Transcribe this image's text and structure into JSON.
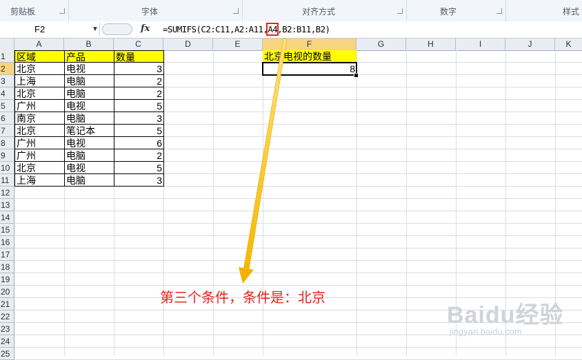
{
  "ribbon": {
    "groups": [
      {
        "label": "剪贴板"
      },
      {
        "label": "字体"
      },
      {
        "label": "对齐方式"
      },
      {
        "label": "数字"
      },
      {
        "label": "样式"
      }
    ]
  },
  "formula_bar": {
    "name_box": "F2",
    "fx_label": "fx",
    "formula_before": "=SUMIFS(C2:C11,A2:A11,",
    "formula_highlight": "A4",
    "formula_after": ",B2:B11,B2)"
  },
  "columns": [
    "A",
    "B",
    "C",
    "D",
    "E",
    "F",
    "G",
    "H",
    "I",
    "J",
    "K"
  ],
  "selected_column": "F",
  "rows": [
    "1",
    "2",
    "3",
    "4",
    "5",
    "6",
    "7",
    "8",
    "9",
    "10",
    "11",
    "12",
    "13",
    "14",
    "15",
    "16",
    "17",
    "18",
    "19",
    "20",
    "21",
    "22",
    "23",
    "24",
    "25"
  ],
  "selected_row": "2",
  "table": {
    "headers": [
      "区域",
      "产品",
      "数量"
    ],
    "rows": [
      [
        "北京",
        "电视",
        "3"
      ],
      [
        "上海",
        "电脑",
        "2"
      ],
      [
        "北京",
        "电脑",
        "2"
      ],
      [
        "广州",
        "电视",
        "5"
      ],
      [
        "南京",
        "电脑",
        "3"
      ],
      [
        "北京",
        "笔记本",
        "5"
      ],
      [
        "广州",
        "电视",
        "6"
      ],
      [
        "广州",
        "电脑",
        "2"
      ],
      [
        "北京",
        "电视",
        "5"
      ],
      [
        "上海",
        "电脑",
        "3"
      ]
    ]
  },
  "result": {
    "header": "北京电视的数量",
    "value": "8"
  },
  "annotation": "第三个条件，条件是：北京",
  "watermark": {
    "brand": "Baidu经验",
    "url": "jingyan.baidu.com"
  },
  "colors": {
    "header_fill": "#ffff00",
    "selected_header": "#f7d57e",
    "annotation": "#e8231b",
    "arrow": "#f5b800"
  }
}
